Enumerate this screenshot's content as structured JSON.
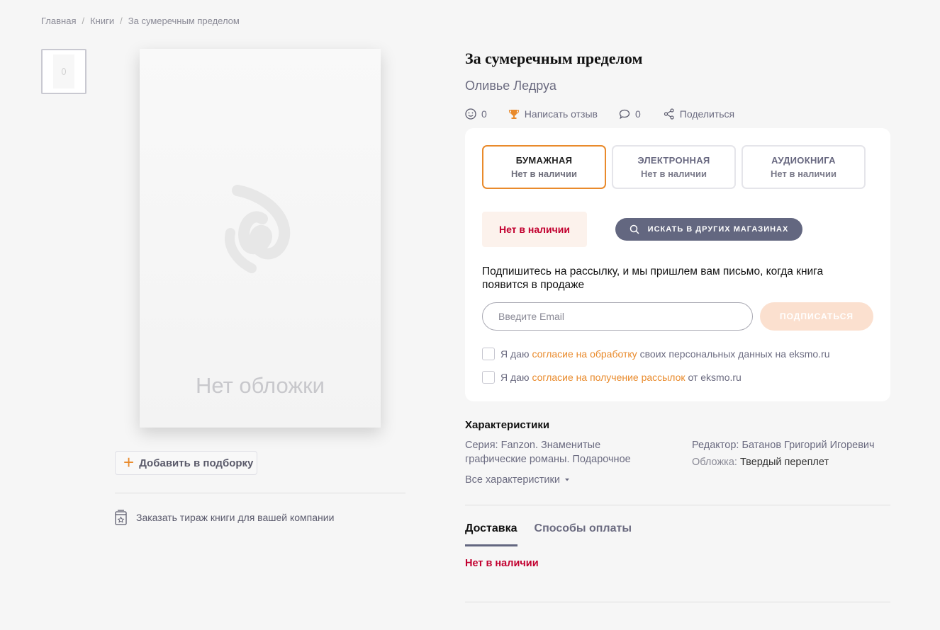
{
  "breadcrumb": {
    "home": "Главная",
    "books": "Книги",
    "current": "За сумеречным пределом"
  },
  "cover": {
    "placeholder_text": "Нет обложки"
  },
  "actions": {
    "add_to_collection": "Добавить в подборку",
    "order_bulk": "Заказать тираж книги для вашей компании"
  },
  "book": {
    "title": "За сумеречным пределом",
    "author": "Оливье Ледруа"
  },
  "meta": {
    "likes": "0",
    "review_label": "Написать отзыв",
    "comments": "0",
    "share_label": "Поделиться"
  },
  "formats": [
    {
      "name": "БУМАЖНАЯ",
      "status": "Нет в наличии"
    },
    {
      "name": "ЭЛЕКТРОННАЯ",
      "status": "Нет в наличии"
    },
    {
      "name": "АУДИОКНИГА",
      "status": "Нет в наличии"
    }
  ],
  "availability": {
    "status": "Нет в наличии",
    "search_other": "ИСКАТЬ В ДРУГИХ МАГАЗИНАХ"
  },
  "subscribe": {
    "text": "Подпишитесь на рассылку, и мы пришлем вам письмо, когда книга появится в продаже",
    "email_placeholder": "Введите Email",
    "button": "ПОДПИСАТЬСЯ",
    "consent1": {
      "pre": "Я даю",
      "link": "согласие на обработку",
      "post": "своих персональных данных на eksmo.ru"
    },
    "consent2": {
      "pre": "Я даю",
      "link": "согласие на получение рассылок",
      "post": "от eksmo.ru"
    }
  },
  "characteristics": {
    "title": "Характеристики",
    "series_label": "Серия:",
    "series_value": "Fanzon. Знаменитые графические романы. Подарочное",
    "editor_label": "Редактор:",
    "editor_value": "Батанов Григорий Игоревич",
    "cover_label": "Обложка:",
    "cover_value": "Твердый переплет",
    "all_link": "Все характеристики"
  },
  "tabs": [
    {
      "label": "Доставка"
    },
    {
      "label": "Способы оплаты"
    }
  ],
  "delivery": {
    "status": "Нет в наличии"
  },
  "colors": {
    "accent": "#e98a2b",
    "danger": "#c2002f",
    "button_dark": "#636780"
  }
}
